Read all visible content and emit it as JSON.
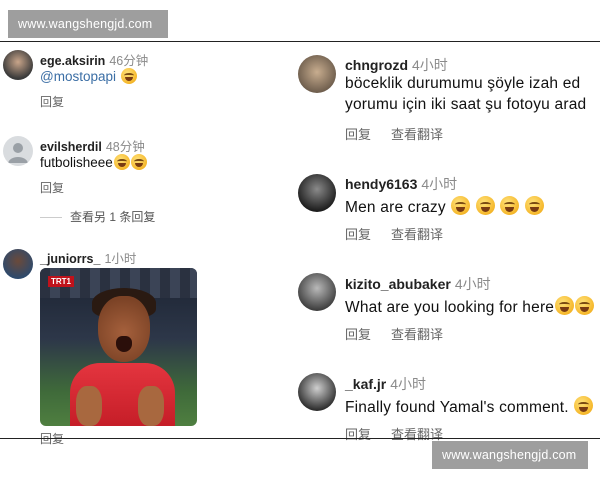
{
  "watermark": {
    "top": "www.wangshengjd.com",
    "bottom": "www.wangshengjd.com"
  },
  "left": {
    "comments": [
      {
        "user": "ege.aksirin",
        "time": "46分钟",
        "text": "@mostopapi",
        "emoji_count": 1,
        "reply": "回复"
      },
      {
        "user": "evilsherdil",
        "time": "48分钟",
        "text": "futbolisheee",
        "emoji_count": 2,
        "reply": "回复",
        "more_replies": "查看另 1 条回复"
      },
      {
        "user": "_juniorrs_",
        "time": "1小时",
        "reply": "回复",
        "gif_badge": "TRT1"
      }
    ]
  },
  "right": {
    "comments": [
      {
        "user": "chngrozd",
        "time": "4小时",
        "line1": "böceklik durumumu şöyle izah ed",
        "line2": "yorumu için iki saat şu fotoyu arad",
        "reply": "回复",
        "translate": "查看翻译"
      },
      {
        "user": "hendy6163",
        "time": "4小时",
        "text": "Men are crazy",
        "emoji_count": 4,
        "reply": "回复",
        "translate": "查看翻译"
      },
      {
        "user": "kizito_abubaker",
        "time": "4小时",
        "text": "What are you looking for here",
        "emoji_count": 2,
        "reply": "回复",
        "translate": "查看翻译"
      },
      {
        "user": "_kaf.jr",
        "time": "4小时",
        "text": "Finally found Yamal's comment.",
        "emoji_count": 1,
        "reply": "回复",
        "translate": "查看翻译"
      }
    ]
  },
  "colors": {
    "mention": "#3b6ea5",
    "timestamp": "#8a8a8a",
    "watermark_bg": "#9e9e9e"
  }
}
